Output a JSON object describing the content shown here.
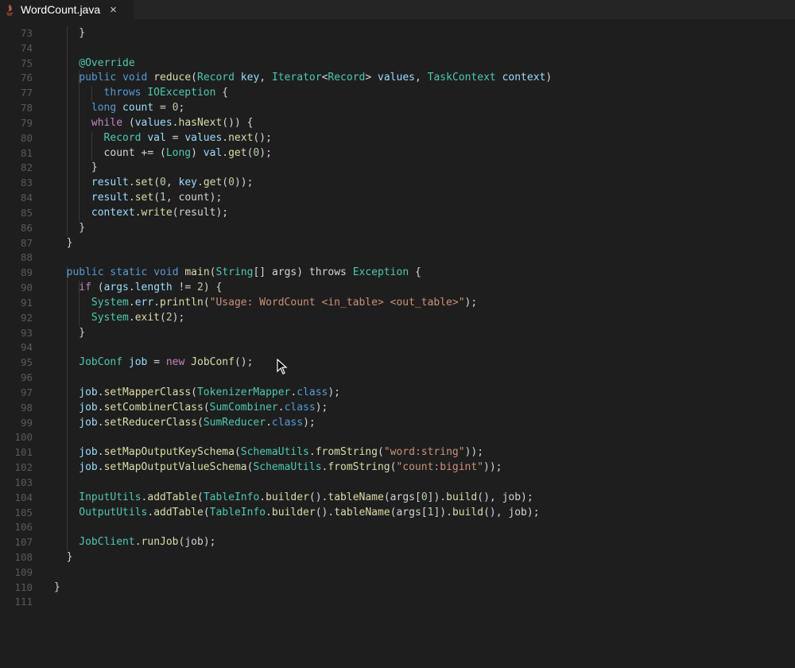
{
  "tab": {
    "title": "WordCount.java",
    "close_glyph": "×",
    "icon": "java-file-icon"
  },
  "colors": {
    "background": "#1e1e1e",
    "keyword": "#569cd6",
    "control": "#c586c0",
    "type": "#4ec9b0",
    "function": "#dcdcaa",
    "variable": "#9cdcfe",
    "string": "#ce9178",
    "number": "#b5cea8"
  },
  "lines": [
    {
      "n": "73",
      "tokens": [
        [
          "pl",
          "}"
        ]
      ]
    },
    {
      "n": "74",
      "tokens": []
    },
    {
      "n": "75",
      "tokens": [
        [
          "ann",
          "@Override"
        ]
      ]
    },
    {
      "n": "76",
      "tokens": [
        [
          "kw",
          "public"
        ],
        [
          "pl",
          " "
        ],
        [
          "kw",
          "void"
        ],
        [
          "pl",
          " "
        ],
        [
          "fn",
          "reduce"
        ],
        [
          "pl",
          "("
        ],
        [
          "ty",
          "Record"
        ],
        [
          "pl",
          " "
        ],
        [
          "var",
          "key"
        ],
        [
          "pl",
          ", "
        ],
        [
          "ty",
          "Iterator"
        ],
        [
          "pl",
          "<"
        ],
        [
          "ty",
          "Record"
        ],
        [
          "pl",
          "> "
        ],
        [
          "var",
          "values"
        ],
        [
          "pl",
          ", "
        ],
        [
          "ty",
          "TaskContext"
        ],
        [
          "pl",
          " "
        ],
        [
          "var",
          "context"
        ],
        [
          "pl",
          ")"
        ]
      ]
    },
    {
      "n": "77",
      "tokens": [
        [
          "kw",
          "throws"
        ],
        [
          "pl",
          " "
        ],
        [
          "ty",
          "IOException"
        ],
        [
          "pl",
          " {"
        ]
      ]
    },
    {
      "n": "78",
      "tokens": [
        [
          "kw",
          "long"
        ],
        [
          "pl",
          " "
        ],
        [
          "var",
          "count"
        ],
        [
          "pl",
          " = "
        ],
        [
          "num",
          "0"
        ],
        [
          "pl",
          ";"
        ]
      ]
    },
    {
      "n": "79",
      "tokens": [
        [
          "ctl",
          "while"
        ],
        [
          "pl",
          " ("
        ],
        [
          "var",
          "values"
        ],
        [
          "pl",
          "."
        ],
        [
          "fn",
          "hasNext"
        ],
        [
          "pl",
          "()) {"
        ]
      ]
    },
    {
      "n": "80",
      "tokens": [
        [
          "ty",
          "Record"
        ],
        [
          "pl",
          " "
        ],
        [
          "var",
          "val"
        ],
        [
          "pl",
          " = "
        ],
        [
          "var",
          "values"
        ],
        [
          "pl",
          "."
        ],
        [
          "fn",
          "next"
        ],
        [
          "pl",
          "();"
        ]
      ]
    },
    {
      "n": "81",
      "tokens": [
        [
          "pl",
          "count += ("
        ],
        [
          "ty",
          "Long"
        ],
        [
          "pl",
          ") "
        ],
        [
          "var",
          "val"
        ],
        [
          "pl",
          "."
        ],
        [
          "fn",
          "get"
        ],
        [
          "pl",
          "("
        ],
        [
          "num",
          "0"
        ],
        [
          "pl",
          ");"
        ]
      ]
    },
    {
      "n": "82",
      "tokens": [
        [
          "pl",
          "}"
        ]
      ]
    },
    {
      "n": "83",
      "tokens": [
        [
          "var",
          "result"
        ],
        [
          "pl",
          "."
        ],
        [
          "fn",
          "set"
        ],
        [
          "pl",
          "("
        ],
        [
          "num",
          "0"
        ],
        [
          "pl",
          ", "
        ],
        [
          "var",
          "key"
        ],
        [
          "pl",
          "."
        ],
        [
          "fn",
          "get"
        ],
        [
          "pl",
          "("
        ],
        [
          "num",
          "0"
        ],
        [
          "pl",
          "));"
        ]
      ]
    },
    {
      "n": "84",
      "tokens": [
        [
          "var",
          "result"
        ],
        [
          "pl",
          "."
        ],
        [
          "fn",
          "set"
        ],
        [
          "pl",
          "("
        ],
        [
          "num",
          "1"
        ],
        [
          "pl",
          ", count);"
        ]
      ]
    },
    {
      "n": "85",
      "tokens": [
        [
          "var",
          "context"
        ],
        [
          "pl",
          "."
        ],
        [
          "fn",
          "write"
        ],
        [
          "pl",
          "(result);"
        ]
      ]
    },
    {
      "n": "86",
      "tokens": [
        [
          "pl",
          "}"
        ]
      ]
    },
    {
      "n": "87",
      "tokens": [
        [
          "pl",
          "}"
        ]
      ]
    },
    {
      "n": "88",
      "tokens": []
    },
    {
      "n": "89",
      "tokens": [
        [
          "kw",
          "public"
        ],
        [
          "pl",
          " "
        ],
        [
          "kw",
          "static"
        ],
        [
          "pl",
          " "
        ],
        [
          "kw",
          "void"
        ],
        [
          "pl",
          " "
        ],
        [
          "fn",
          "main"
        ],
        [
          "pl",
          "("
        ],
        [
          "ty",
          "String"
        ],
        [
          "pl",
          "[] args) throws "
        ],
        [
          "ty",
          "Exception"
        ],
        [
          "pl",
          " {"
        ]
      ]
    },
    {
      "n": "90",
      "tokens": [
        [
          "ctl",
          "if"
        ],
        [
          "pl",
          " ("
        ],
        [
          "var",
          "args"
        ],
        [
          "pl",
          "."
        ],
        [
          "var",
          "length"
        ],
        [
          "pl",
          " != "
        ],
        [
          "num",
          "2"
        ],
        [
          "pl",
          ") {"
        ]
      ]
    },
    {
      "n": "91",
      "tokens": [
        [
          "ty",
          "System"
        ],
        [
          "pl",
          "."
        ],
        [
          "var",
          "err"
        ],
        [
          "pl",
          "."
        ],
        [
          "fn",
          "println"
        ],
        [
          "pl",
          "("
        ],
        [
          "str",
          "\"Usage: WordCount <in_table> <out_table>\""
        ],
        [
          "pl",
          ");"
        ]
      ]
    },
    {
      "n": "92",
      "tokens": [
        [
          "ty",
          "System"
        ],
        [
          "pl",
          "."
        ],
        [
          "fn",
          "exit"
        ],
        [
          "pl",
          "("
        ],
        [
          "num",
          "2"
        ],
        [
          "pl",
          ");"
        ]
      ]
    },
    {
      "n": "93",
      "tokens": [
        [
          "pl",
          "}"
        ]
      ]
    },
    {
      "n": "94",
      "tokens": []
    },
    {
      "n": "95",
      "tokens": [
        [
          "ty",
          "JobConf"
        ],
        [
          "pl",
          " "
        ],
        [
          "var",
          "job"
        ],
        [
          "pl",
          " = "
        ],
        [
          "ctl",
          "new"
        ],
        [
          "pl",
          " "
        ],
        [
          "fn",
          "JobConf"
        ],
        [
          "pl",
          "();"
        ]
      ]
    },
    {
      "n": "96",
      "tokens": []
    },
    {
      "n": "97",
      "tokens": [
        [
          "var",
          "job"
        ],
        [
          "pl",
          "."
        ],
        [
          "fn",
          "setMapperClass"
        ],
        [
          "pl",
          "("
        ],
        [
          "ty",
          "TokenizerMapper"
        ],
        [
          "pl",
          "."
        ],
        [
          "kw",
          "class"
        ],
        [
          "pl",
          ");"
        ]
      ]
    },
    {
      "n": "98",
      "tokens": [
        [
          "var",
          "job"
        ],
        [
          "pl",
          "."
        ],
        [
          "fn",
          "setCombinerClass"
        ],
        [
          "pl",
          "("
        ],
        [
          "ty",
          "SumCombiner"
        ],
        [
          "pl",
          "."
        ],
        [
          "kw",
          "class"
        ],
        [
          "pl",
          ");"
        ]
      ]
    },
    {
      "n": "99",
      "tokens": [
        [
          "var",
          "job"
        ],
        [
          "pl",
          "."
        ],
        [
          "fn",
          "setReducerClass"
        ],
        [
          "pl",
          "("
        ],
        [
          "ty",
          "SumReducer"
        ],
        [
          "pl",
          "."
        ],
        [
          "kw",
          "class"
        ],
        [
          "pl",
          ");"
        ]
      ]
    },
    {
      "n": "100",
      "tokens": []
    },
    {
      "n": "101",
      "tokens": [
        [
          "var",
          "job"
        ],
        [
          "pl",
          "."
        ],
        [
          "fn",
          "setMapOutputKeySchema"
        ],
        [
          "pl",
          "("
        ],
        [
          "ty",
          "SchemaUtils"
        ],
        [
          "pl",
          "."
        ],
        [
          "fn",
          "fromString"
        ],
        [
          "pl",
          "("
        ],
        [
          "str",
          "\"word:string\""
        ],
        [
          "pl",
          "));"
        ]
      ]
    },
    {
      "n": "102",
      "tokens": [
        [
          "var",
          "job"
        ],
        [
          "pl",
          "."
        ],
        [
          "fn",
          "setMapOutputValueSchema"
        ],
        [
          "pl",
          "("
        ],
        [
          "ty",
          "SchemaUtils"
        ],
        [
          "pl",
          "."
        ],
        [
          "fn",
          "fromString"
        ],
        [
          "pl",
          "("
        ],
        [
          "str",
          "\"count:bigint\""
        ],
        [
          "pl",
          "));"
        ]
      ]
    },
    {
      "n": "103",
      "tokens": []
    },
    {
      "n": "104",
      "tokens": [
        [
          "ty",
          "InputUtils"
        ],
        [
          "pl",
          "."
        ],
        [
          "fn",
          "addTable"
        ],
        [
          "pl",
          "("
        ],
        [
          "ty",
          "TableInfo"
        ],
        [
          "pl",
          "."
        ],
        [
          "fn",
          "builder"
        ],
        [
          "pl",
          "()."
        ],
        [
          "fn",
          "tableName"
        ],
        [
          "pl",
          "(args["
        ],
        [
          "num",
          "0"
        ],
        [
          "pl",
          "])."
        ],
        [
          "fn",
          "build"
        ],
        [
          "pl",
          "(), job);"
        ]
      ]
    },
    {
      "n": "105",
      "tokens": [
        [
          "ty",
          "OutputUtils"
        ],
        [
          "pl",
          "."
        ],
        [
          "fn",
          "addTable"
        ],
        [
          "pl",
          "("
        ],
        [
          "ty",
          "TableInfo"
        ],
        [
          "pl",
          "."
        ],
        [
          "fn",
          "builder"
        ],
        [
          "pl",
          "()."
        ],
        [
          "fn",
          "tableName"
        ],
        [
          "pl",
          "(args["
        ],
        [
          "num",
          "1"
        ],
        [
          "pl",
          "])."
        ],
        [
          "fn",
          "build"
        ],
        [
          "pl",
          "(), job);"
        ]
      ]
    },
    {
      "n": "106",
      "tokens": []
    },
    {
      "n": "107",
      "tokens": [
        [
          "ty",
          "JobClient"
        ],
        [
          "pl",
          "."
        ],
        [
          "fn",
          "runJob"
        ],
        [
          "pl",
          "(job);"
        ]
      ]
    },
    {
      "n": "108",
      "tokens": [
        [
          "pl",
          "}"
        ]
      ]
    },
    {
      "n": "109",
      "tokens": []
    },
    {
      "n": "110",
      "tokens": [
        [
          "pl",
          "}"
        ]
      ]
    },
    {
      "n": "111",
      "tokens": []
    }
  ]
}
